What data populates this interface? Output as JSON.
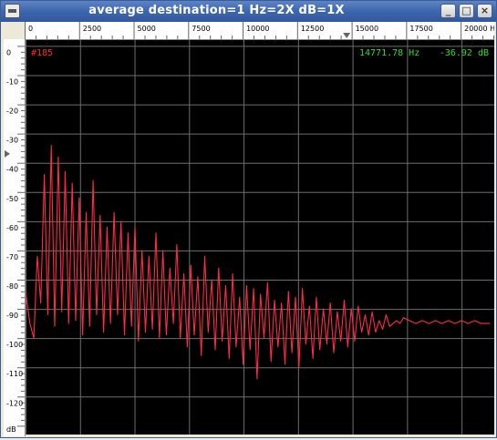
{
  "window": {
    "title": "average   destination=1 Hz=2X dB=1X",
    "buttons": {
      "menu": "menu-icon",
      "minimize": "_",
      "maximize": "□",
      "close": "×"
    }
  },
  "ruler_x": {
    "labels": [
      "0",
      "2500",
      "5000",
      "7500",
      "10000",
      "12500",
      "15000",
      "17500",
      "20000 Hz"
    ]
  },
  "ruler_y": {
    "labels": [
      "0",
      "-10",
      "-20",
      "-30",
      "-40",
      "-50",
      "-60",
      "-70",
      "-80",
      "-90",
      "-100",
      "-110",
      "-120"
    ],
    "unit": "dB"
  },
  "readout": {
    "frame": "#185",
    "frequency": "14771.78 Hz",
    "level": "-36.92 dB"
  },
  "colors": {
    "plot_background": "#000000",
    "grid": "#6e6e6e",
    "trace": "#ff2a4a",
    "frame_label": "#ff2a2a",
    "readout_text": "#33dd33"
  },
  "chart_data": {
    "type": "line",
    "xlim": [
      0,
      21500
    ],
    "ylim": [
      -133,
      2
    ],
    "grid": true,
    "series": [
      {
        "x": [
          0,
          200,
          380,
          540,
          700,
          860,
          1020,
          1180,
          1340,
          1500,
          1660,
          1820,
          1980,
          2140,
          2300,
          2460,
          2620,
          2780,
          2940,
          3100,
          3260,
          3420,
          3580,
          3740,
          3900,
          4060,
          4220,
          4380,
          4540,
          4700,
          4860,
          5020,
          5180,
          5340,
          5500,
          5660,
          5820,
          5980,
          6140,
          6300,
          6460,
          6620,
          6780,
          6940,
          7100,
          7260,
          7420,
          7580,
          7740,
          7900,
          8060,
          8220,
          8380,
          8540,
          8700,
          8860,
          9020,
          9180,
          9340,
          9500,
          9660,
          9820,
          9980,
          10140,
          10300,
          10460,
          10620,
          10780,
          10940,
          11100,
          11260,
          11420,
          11580,
          11740,
          11900,
          12060,
          12220,
          12380,
          12540,
          12700,
          12860,
          13020,
          13180,
          13340,
          13500,
          13660,
          13820,
          13980,
          14140,
          14300,
          14460,
          14620,
          14780,
          14940,
          15100,
          15260,
          15420,
          15580,
          15740,
          15900,
          16060,
          16220,
          16380,
          16540,
          16700,
          16860,
          17020,
          17180,
          17340,
          17600,
          17900,
          18200,
          18500,
          18800,
          19100,
          19400,
          19700,
          20000,
          20300,
          20600,
          20900,
          21300
        ],
        "y": [
          -84,
          -95,
          -100,
          -72,
          -88,
          -44,
          -92,
          -34,
          -96,
          -38,
          -91,
          -43,
          -95,
          -47,
          -94,
          -52,
          -99,
          -57,
          -96,
          -46,
          -92,
          -58,
          -98,
          -62,
          -95,
          -57,
          -92,
          -60,
          -99,
          -64,
          -96,
          -62,
          -101,
          -70,
          -98,
          -72,
          -97,
          -64,
          -100,
          -70,
          -99,
          -76,
          -95,
          -68,
          -100,
          -78,
          -103,
          -75,
          -99,
          -79,
          -106,
          -72,
          -98,
          -80,
          -104,
          -76,
          -101,
          -82,
          -107,
          -78,
          -103,
          -86,
          -109,
          -82,
          -104,
          -83,
          -114,
          -85,
          -100,
          -81,
          -108,
          -87,
          -103,
          -88,
          -109,
          -84,
          -105,
          -86,
          -110,
          -83,
          -102,
          -89,
          -107,
          -86,
          -104,
          -90,
          -102,
          -88,
          -105,
          -91,
          -101,
          -87,
          -103,
          -90,
          -101,
          -89,
          -98,
          -92,
          -99,
          -91,
          -98,
          -94,
          -97,
          -92,
          -96,
          -95,
          -94,
          -95,
          -93,
          -94,
          -95,
          -94,
          -95,
          -94,
          -95,
          -94,
          -95,
          -94,
          -95,
          -94,
          -95,
          -95
        ]
      }
    ]
  }
}
